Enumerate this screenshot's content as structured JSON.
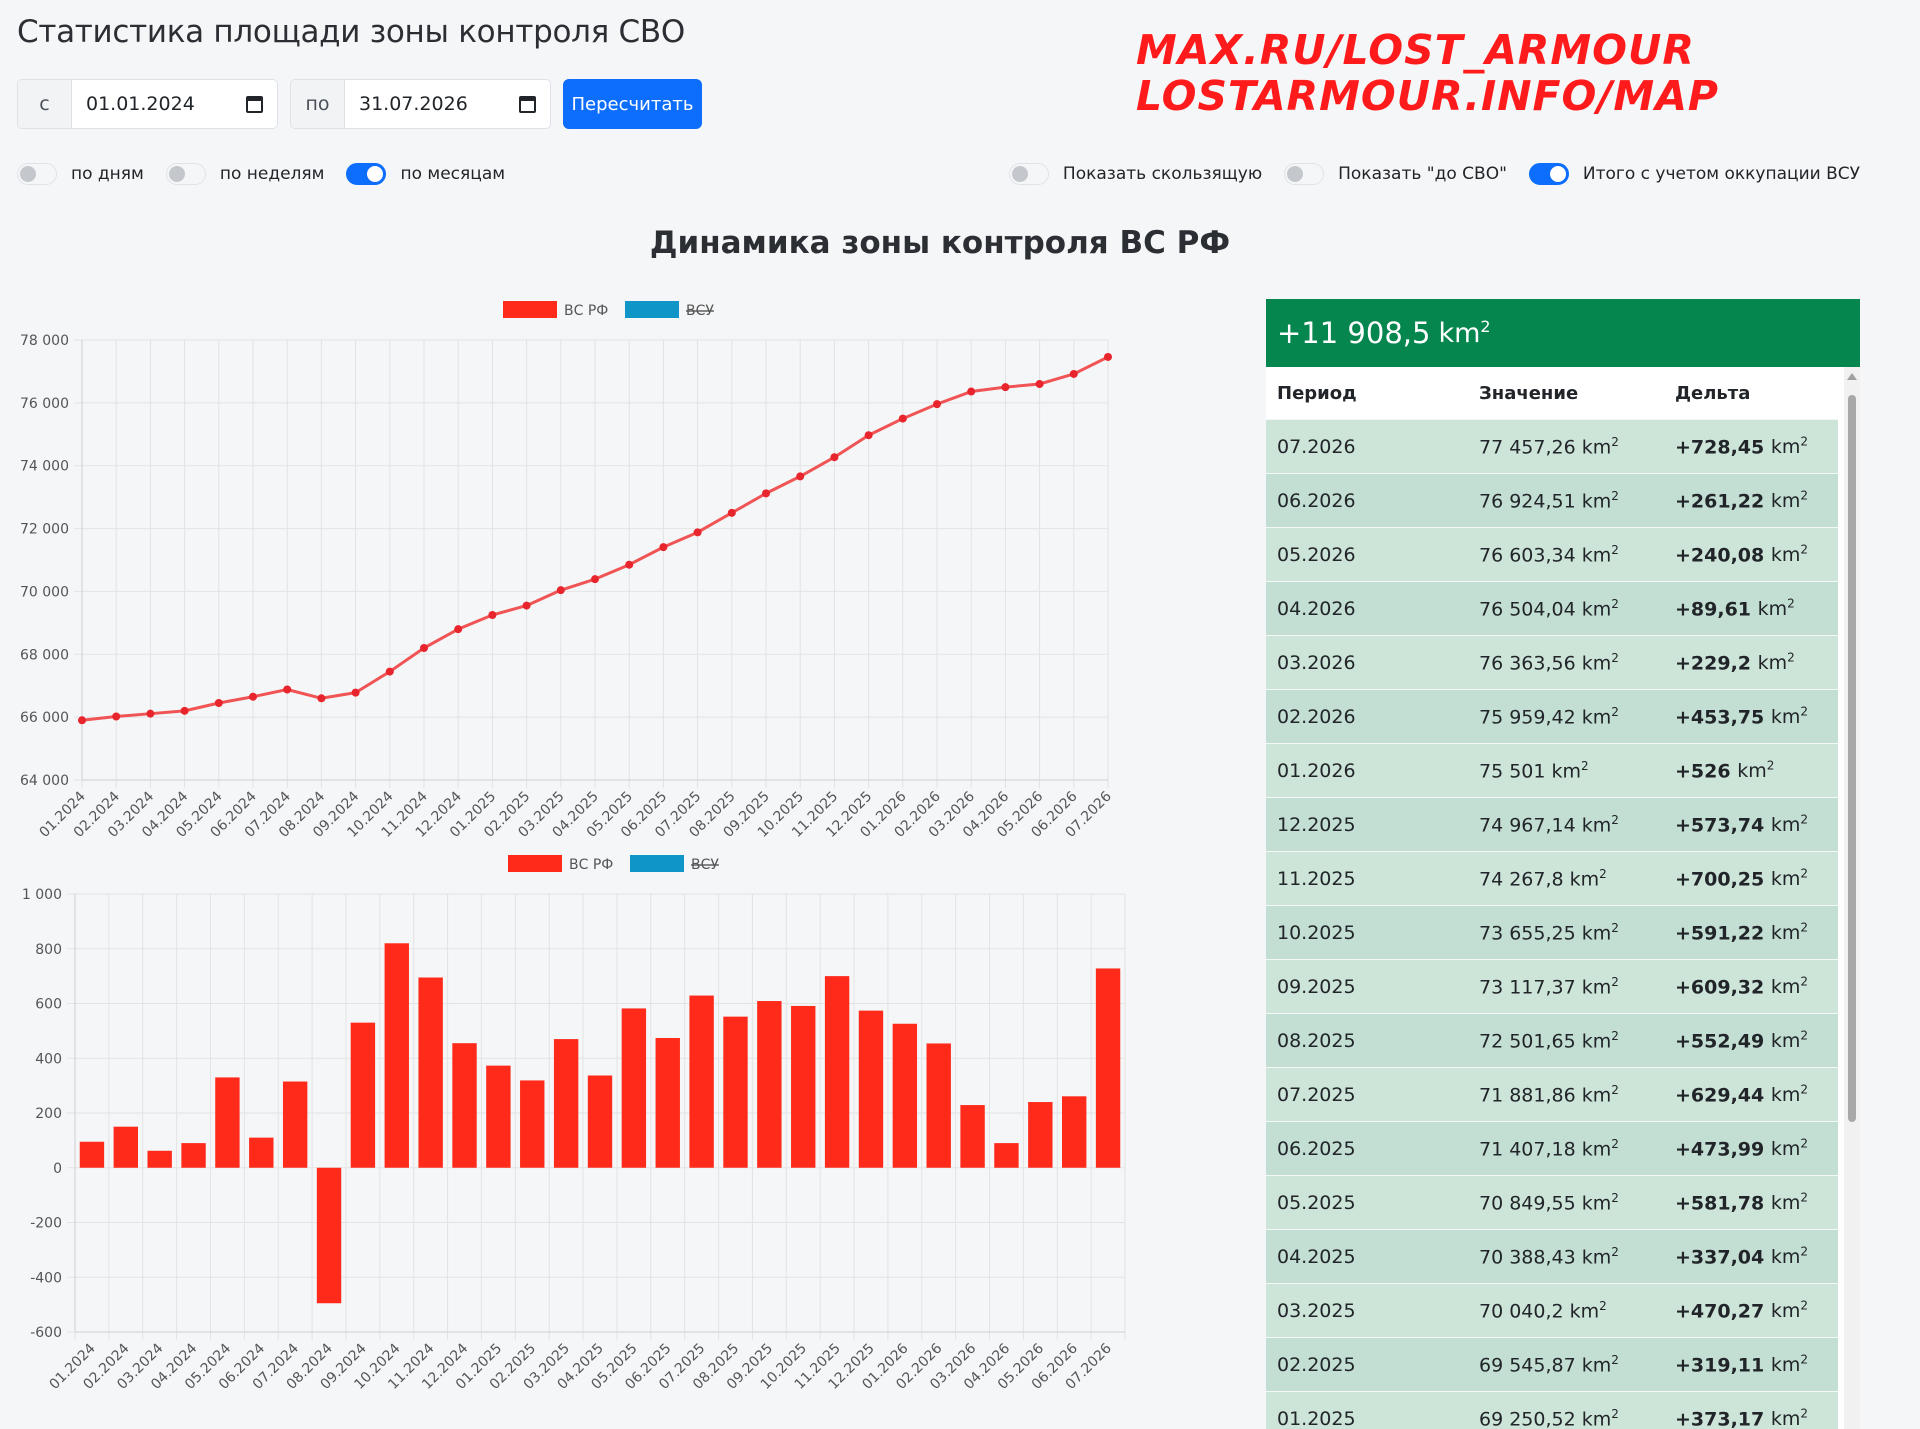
{
  "page": {
    "title": "Статистика площади зоны контроля СВО"
  },
  "watermark": {
    "line1": "MAX.RU/LOST_ARMOUR",
    "line2": "LOSTARMOUR.INFO/MAP"
  },
  "filters": {
    "from_prefix": "с",
    "from_value": "01.01.2024",
    "to_prefix": "по",
    "to_value": "31.07.2026",
    "recalc_label": "Пересчитать"
  },
  "toggles": {
    "by_days": "по дням",
    "by_days_on": false,
    "by_weeks": "по неделям",
    "by_weeks_on": false,
    "by_months": "по месяцам",
    "by_months_on": true,
    "show_moving": "Показать скользящую",
    "show_moving_on": false,
    "show_before": "Показать \"до СВО\"",
    "show_before_on": false,
    "total_with_occ": "Итого с учетом оккупации ВСУ",
    "total_with_occ_on": true
  },
  "chart_title": "Динамика зоны контроля ВС РФ",
  "summary": {
    "value": "+11 908,5",
    "unit": "km",
    "sup": "2"
  },
  "table": {
    "headers": [
      "Период",
      "Значение",
      "Дельта"
    ],
    "unit": "km",
    "sup": "2",
    "rows": [
      {
        "period": "07.2026",
        "value": "77 457,26",
        "delta": "+728,45"
      },
      {
        "period": "06.2026",
        "value": "76 924,51",
        "delta": "+261,22"
      },
      {
        "period": "05.2026",
        "value": "76 603,34",
        "delta": "+240,08"
      },
      {
        "period": "04.2026",
        "value": "76 504,04",
        "delta": "+89,61"
      },
      {
        "period": "03.2026",
        "value": "76 363,56",
        "delta": "+229,2"
      },
      {
        "period": "02.2026",
        "value": "75 959,42",
        "delta": "+453,75"
      },
      {
        "period": "01.2026",
        "value": "75 501",
        "delta": "+526"
      },
      {
        "period": "12.2025",
        "value": "74 967,14",
        "delta": "+573,74"
      },
      {
        "period": "11.2025",
        "value": "74 267,8",
        "delta": "+700,25"
      },
      {
        "period": "10.2025",
        "value": "73 655,25",
        "delta": "+591,22"
      },
      {
        "period": "09.2025",
        "value": "73 117,37",
        "delta": "+609,32"
      },
      {
        "period": "08.2025",
        "value": "72 501,65",
        "delta": "+552,49"
      },
      {
        "period": "07.2025",
        "value": "71 881,86",
        "delta": "+629,44"
      },
      {
        "period": "06.2025",
        "value": "71 407,18",
        "delta": "+473,99"
      },
      {
        "period": "05.2025",
        "value": "70 849,55",
        "delta": "+581,78"
      },
      {
        "period": "04.2025",
        "value": "70 388,43",
        "delta": "+337,04"
      },
      {
        "period": "03.2025",
        "value": "70 040,2",
        "delta": "+470,27"
      },
      {
        "period": "02.2025",
        "value": "69 545,87",
        "delta": "+319,11"
      },
      {
        "period": "01.2025",
        "value": "69 250,52",
        "delta": "+373,17"
      }
    ]
  },
  "chart_data": [
    {
      "type": "line",
      "legend": [
        {
          "name": "ВС РФ",
          "color": "#ff2a1a"
        },
        {
          "name": "ВСУ",
          "color": "#1095c8",
          "hidden": true
        }
      ],
      "categories": [
        "01.2024",
        "02.2024",
        "03.2024",
        "04.2024",
        "05.2024",
        "06.2024",
        "07.2024",
        "08.2024",
        "09.2024",
        "10.2024",
        "11.2024",
        "12.2024",
        "01.2025",
        "02.2025",
        "03.2025",
        "04.2025",
        "05.2025",
        "06.2025",
        "07.2025",
        "08.2025",
        "09.2025",
        "10.2025",
        "11.2025",
        "12.2025",
        "01.2026",
        "02.2026",
        "03.2026",
        "04.2026",
        "05.2026",
        "06.2026",
        "07.2026"
      ],
      "series": [
        {
          "name": "ВС РФ",
          "color": "#f05454",
          "values": [
            65900,
            66020,
            66110,
            66200,
            66450,
            66650,
            66880,
            66600,
            66780,
            67450,
            68200,
            68800,
            69250,
            69550,
            70040,
            70390,
            70850,
            71410,
            71880,
            72500,
            73120,
            73660,
            74270,
            74970,
            75500,
            75960,
            76360,
            76500,
            76600,
            76920,
            77460
          ]
        }
      ],
      "y_ticks": [
        "64 000",
        "66 000",
        "68 000",
        "70 000",
        "72 000",
        "74 000",
        "76 000",
        "78 000"
      ],
      "ylim": [
        64000,
        78000
      ],
      "grid": true
    },
    {
      "type": "bar",
      "legend": [
        {
          "name": "ВС РФ",
          "color": "#ff2a1a"
        },
        {
          "name": "ВСУ",
          "color": "#1095c8",
          "hidden": true
        }
      ],
      "categories": [
        "01.2024",
        "02.2024",
        "03.2024",
        "04.2024",
        "05.2024",
        "06.2024",
        "07.2024",
        "08.2024",
        "09.2024",
        "10.2024",
        "11.2024",
        "12.2024",
        "01.2025",
        "02.2025",
        "03.2025",
        "04.2025",
        "05.2025",
        "06.2025",
        "07.2025",
        "08.2025",
        "09.2025",
        "10.2025",
        "11.2025",
        "12.2025",
        "01.2026",
        "02.2026",
        "03.2026",
        "04.2026",
        "05.2026",
        "06.2026",
        "07.2026"
      ],
      "series": [
        {
          "name": "ВС РФ",
          "color": "#ff2a1a",
          "values": [
            95,
            150,
            62,
            90,
            330,
            110,
            315,
            -495,
            530,
            820,
            695,
            455,
            373,
            319,
            470,
            337,
            582,
            474,
            629,
            552,
            609,
            591,
            700,
            574,
            526,
            454,
            229,
            90,
            240,
            261,
            728
          ]
        }
      ],
      "y_ticks": [
        "-600",
        "-400",
        "-200",
        "0",
        "200",
        "400",
        "600",
        "800",
        "1 000"
      ],
      "ylim": [
        -600,
        1000
      ],
      "grid": true
    }
  ]
}
